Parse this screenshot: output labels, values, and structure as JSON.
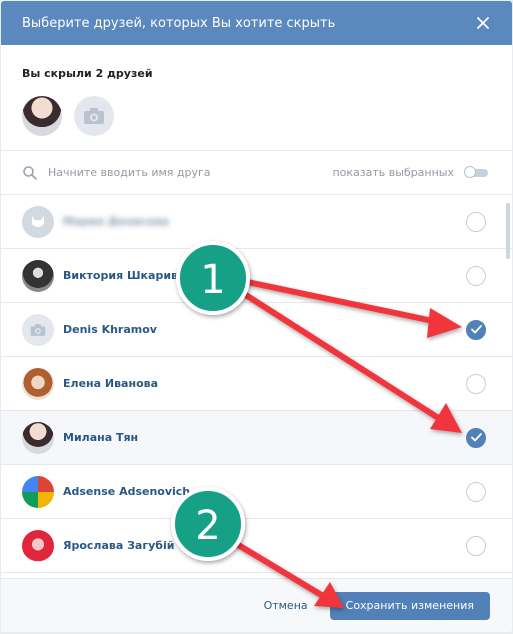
{
  "dialog": {
    "title": "Выберите друзей, которых Вы хотите скрыть",
    "close_icon": "close-icon"
  },
  "hidden": {
    "label": "Вы скрыли 2 друзей"
  },
  "search": {
    "placeholder": "Начните вводить имя друга",
    "show_selected_label": "показать выбранных",
    "show_selected_on": false
  },
  "friends": [
    {
      "name": "Мария Денисова",
      "checked": false,
      "blurred": true
    },
    {
      "name": "Виктория Шкаривская",
      "checked": false
    },
    {
      "name": "Denis Khramov",
      "checked": true
    },
    {
      "name": "Елена Иванова",
      "checked": false
    },
    {
      "name": "Милана Тян",
      "checked": true
    },
    {
      "name": "Adsense Adsenovich",
      "checked": false
    },
    {
      "name": "Ярослава Загубій",
      "checked": false
    }
  ],
  "footer": {
    "cancel_label": "Отмена",
    "save_label": "Сохранить изменения"
  },
  "annotations": {
    "badge_1": "1",
    "badge_2": "2"
  },
  "colors": {
    "header": "#5b88bd",
    "accent": "#5181b8",
    "arrow": "#f0363c",
    "badge": "#16a085"
  }
}
